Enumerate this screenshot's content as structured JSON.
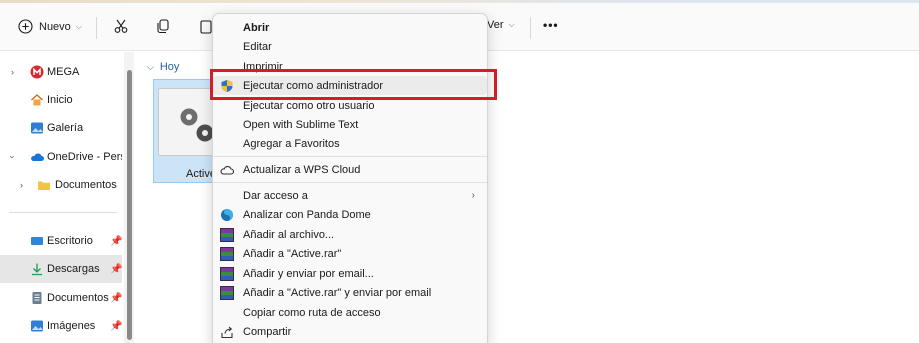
{
  "toolbar": {
    "new_label": "Nuevo",
    "view_label": "Ver",
    "more_label": "•••"
  },
  "sidebar": {
    "items": [
      {
        "label": "MEGA"
      },
      {
        "label": "Inicio"
      },
      {
        "label": "Galería"
      },
      {
        "label": "OneDrive - Personal"
      },
      {
        "label": "Documentos"
      },
      {
        "label": "Escritorio"
      },
      {
        "label": "Descargas"
      },
      {
        "label": "Documentos"
      },
      {
        "label": "Imágenes"
      }
    ]
  },
  "content": {
    "group_label": "Hoy",
    "file_name": "Active"
  },
  "context_menu": {
    "items": [
      "Abrir",
      "Editar",
      "Imprimir",
      "Ejecutar como administrador",
      "Ejecutar como otro usuario",
      "Open with Sublime Text",
      "Agregar a Favoritos",
      "Actualizar a WPS Cloud",
      "Dar acceso a",
      "Analizar con Panda Dome",
      "Añadir al archivo...",
      "Añadir a \"Active.rar\"",
      "Añadir y enviar por email...",
      "Añadir a \"Active.rar\" y enviar por email",
      "Copiar como ruta de acceso",
      "Compartir"
    ]
  },
  "colors": {
    "highlight_border": "#d21e2a",
    "selection_fill": "#cce4f7",
    "accent_blue": "#2a5f9e"
  }
}
